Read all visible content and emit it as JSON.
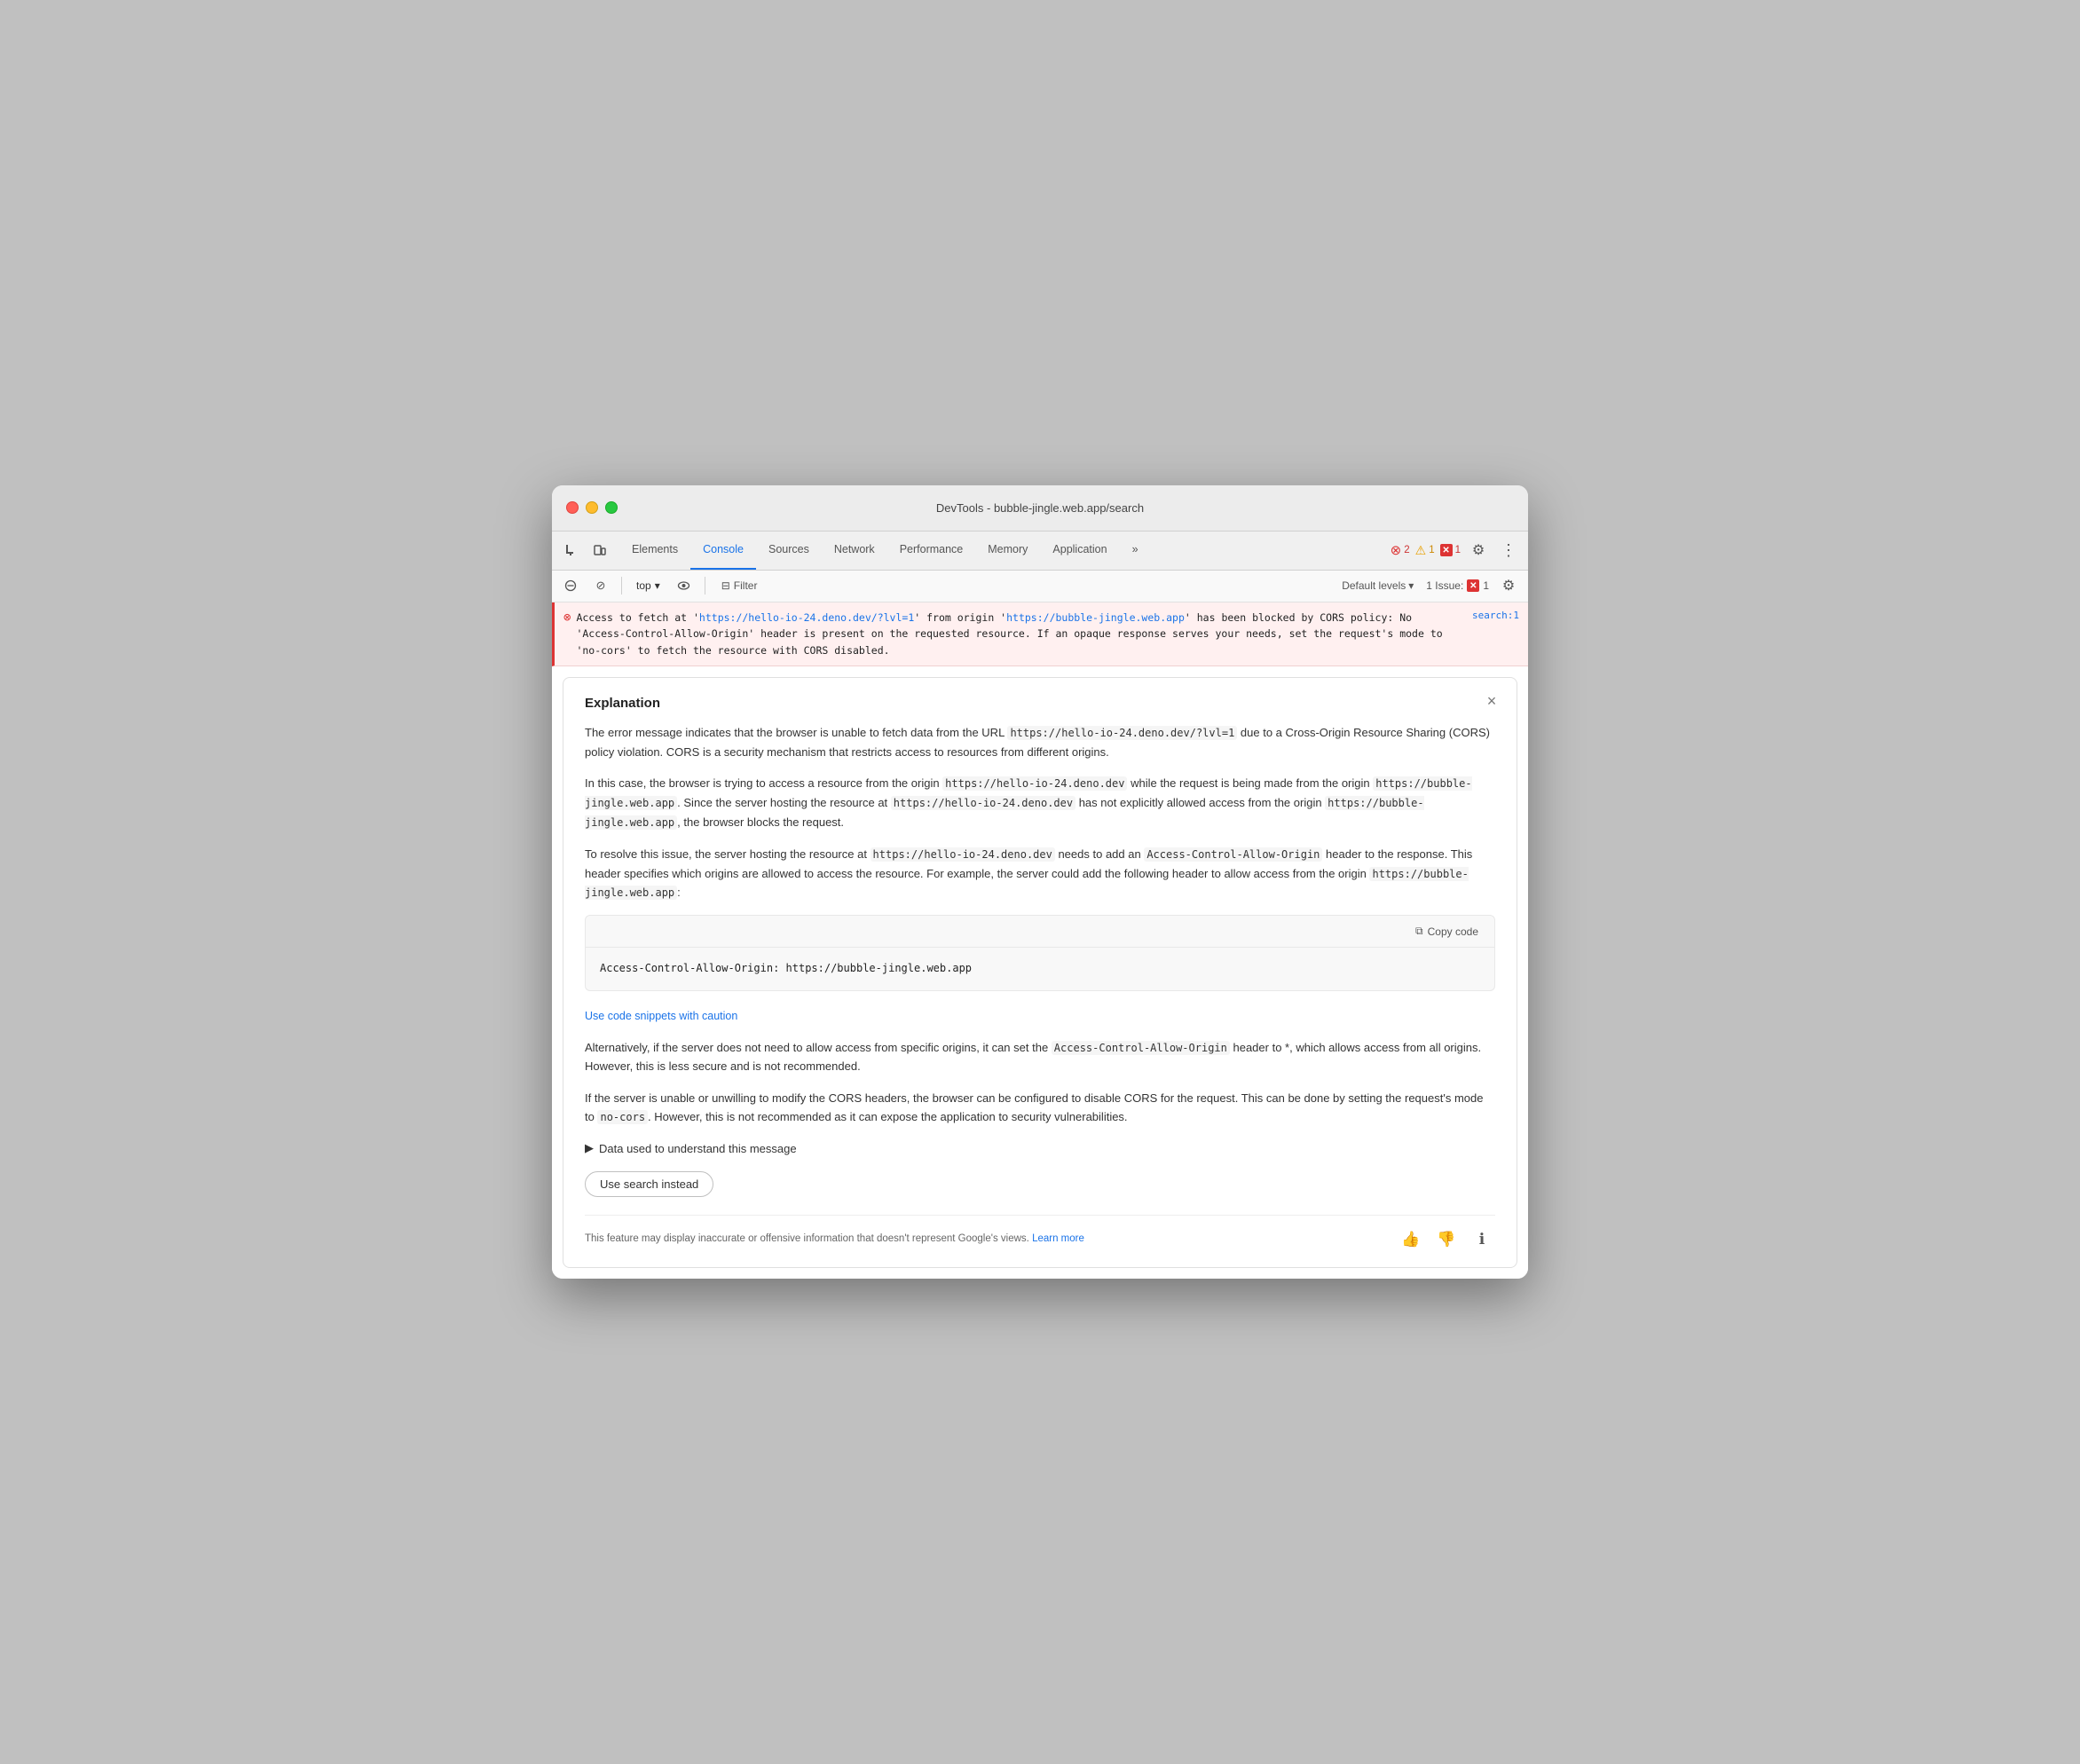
{
  "window": {
    "title": "DevTools - bubble-jingle.web.app/search"
  },
  "tabs": {
    "items": [
      {
        "label": "Elements",
        "active": false
      },
      {
        "label": "Console",
        "active": true
      },
      {
        "label": "Sources",
        "active": false
      },
      {
        "label": "Network",
        "active": false
      },
      {
        "label": "Performance",
        "active": false
      },
      {
        "label": "Memory",
        "active": false
      },
      {
        "label": "Application",
        "active": false
      }
    ],
    "more_label": "»",
    "error_count": "2",
    "warning_count": "1",
    "issue_count": "1"
  },
  "toolbar": {
    "top_label": "top",
    "filter_label": "Filter",
    "default_levels_label": "Default levels",
    "issue_label": "1 Issue:",
    "chevron": "▾"
  },
  "error_row": {
    "message_start": "Access to fetch at '",
    "url1": "https://hello-io-24.deno.dev/?lvl=1",
    "url1_display": "https://hello-io-24.deno.dev/?lvl=1",
    "message_mid": "' from origin '",
    "url2": "https://bubble-jingle.web.app",
    "url2_display": "https://bubble-jingle.web.app",
    "message_end": "' has been blocked by CORS policy: No 'Access-Control-Allow-Origin' header is present on the requested resource. If an opaque response serves your needs, set the request's mode to 'no-cors' to fetch the resource with CORS disabled.",
    "source": "search:1"
  },
  "explanation": {
    "title": "Explanation",
    "close_label": "×",
    "body": {
      "para1_before": "The error message indicates that the browser is unable to fetch data from the URL ",
      "para1_code1": "https://hello-io-24.deno.dev/?lvl=1",
      "para1_after": " due to a Cross-Origin Resource Sharing (CORS) policy violation. CORS is a security mechanism that restricts access to resources from different origins.",
      "para2_before": "In this case, the browser is trying to access a resource from the origin ",
      "para2_code1": "https://hello-io-24.deno.dev",
      "para2_mid1": " while the request is being made from the origin ",
      "para2_code2": "https://bubble-jingle.web.app",
      "para2_mid2": ". Since the server hosting the resource at ",
      "para2_code3": "https://hello-io-24.deno.dev",
      "para2_after1": " has not explicitly allowed access from the origin ",
      "para2_code4": "https://bubble-jingle.web.app",
      "para2_after2": ", the browser blocks the request.",
      "para3_before": "To resolve this issue, the server hosting the resource at ",
      "para3_code1": "https://hello-io-24.deno.dev",
      "para3_mid1": " needs to add an ",
      "para3_code2": "Access-Control-Allow-Origin",
      "para3_mid2": " header to the response. This header specifies which origins are allowed to access the resource. For example, the server could add the following header to allow access from the origin ",
      "para3_code3": "https://bubble-jingle.web.app",
      "para3_after": ":"
    },
    "code": {
      "copy_label": "Copy code",
      "snippet": "Access-Control-Allow-Origin: https://bubble-jingle.web.app",
      "caution_link": "Use code snippets with caution"
    },
    "para4_before": "Alternatively, if the server does not need to allow access from specific origins, it can set the ",
    "para4_code1": "Access-Control-Allow-Origin",
    "para4_after": " header to *, which allows access from all origins. However, this is less secure and is not recommended.",
    "para5_before": "If the server is unable or unwilling to modify the CORS headers, the browser can be configured to disable CORS for the request. This can be done by setting the request's mode to ",
    "para5_code1": "no-cors",
    "para5_after": ". However, this is not recommended as it can expose the application to security vulnerabilities.",
    "disclosure_label": "Data used to understand this message",
    "use_search_label": "Use search instead",
    "disclaimer_text": "This feature may display inaccurate or offensive information that doesn't represent Google's views.",
    "learn_more_label": "Learn more",
    "thumbs_up": "👍",
    "thumbs_down": "👎",
    "info_icon": "ℹ"
  }
}
